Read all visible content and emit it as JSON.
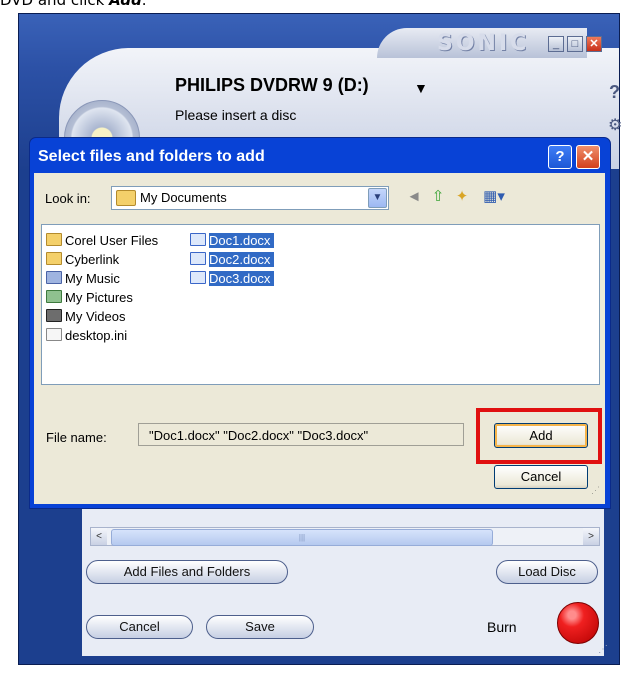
{
  "instruction": {
    "prefix": "DVD and click ",
    "action": "Add",
    "suffix": "."
  },
  "app": {
    "logo": "SONIC",
    "window_buttons": [
      "_",
      "□",
      "✕"
    ],
    "drive_name": "PHILIPS DVDRW 9 (D:)",
    "drive_status": "Please insert a disc",
    "help_glyph": "?",
    "scroll_left": "<",
    "scroll_right": ">",
    "add_files_label": "Add Files and Folders",
    "load_disc_label": "Load Disc",
    "cancel_label": "Cancel",
    "save_label": "Save",
    "burn_label": "Burn",
    "burn_color": "#e01010"
  },
  "dialog": {
    "title": "Select files and folders to add",
    "help_glyph": "?",
    "close_glyph": "✕",
    "look_in_label": "Look in:",
    "look_in_value": "My Documents",
    "items_col1": [
      {
        "name": "Corel User Files",
        "icon": "folder-icon"
      },
      {
        "name": "Cyberlink",
        "icon": "folder-icon"
      },
      {
        "name": "My Music",
        "icon": "music-folder-icon"
      },
      {
        "name": "My Pictures",
        "icon": "pictures-folder-icon"
      },
      {
        "name": "My Videos",
        "icon": "videos-folder-icon"
      },
      {
        "name": "desktop.ini",
        "icon": "settings-file-icon"
      }
    ],
    "items_col2": [
      {
        "name": "Doc1.docx",
        "icon": "word-document-icon",
        "selected": true
      },
      {
        "name": "Doc2.docx",
        "icon": "word-document-icon",
        "selected": true
      },
      {
        "name": "Doc3.docx",
        "icon": "word-document-icon",
        "selected": true
      }
    ],
    "file_name_label": "File name:",
    "file_name_value": "\"Doc1.docx\" \"Doc2.docx\" \"Doc3.docx\"",
    "add_label": "Add",
    "cancel_label": "Cancel",
    "highlight_color": "#e01010",
    "selection_color": "#316ac5"
  }
}
